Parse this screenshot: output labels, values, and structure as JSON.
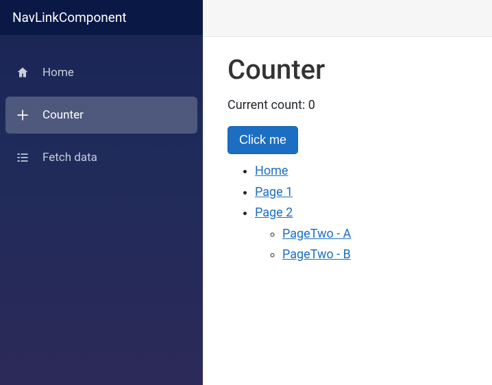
{
  "brand": "NavLinkComponent",
  "sidebar": {
    "items": [
      {
        "label": "Home",
        "icon": "home-icon",
        "active": false
      },
      {
        "label": "Counter",
        "icon": "plus-icon",
        "active": true
      },
      {
        "label": "Fetch data",
        "icon": "list-icon",
        "active": false
      }
    ]
  },
  "page": {
    "title": "Counter",
    "count_label": "Current count: ",
    "count_value": "0",
    "button_label": "Click me"
  },
  "links": {
    "home": "Home",
    "page1": "Page 1",
    "page2": "Page 2",
    "page2a": "PageTwo - A",
    "page2b": "PageTwo - B"
  }
}
